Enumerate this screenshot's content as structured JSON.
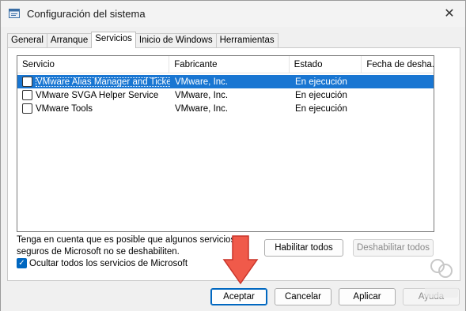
{
  "window": {
    "title": "Configuración del sistema",
    "close_icon": "close-icon",
    "app_icon": "system-config-icon"
  },
  "tabs": [
    {
      "label": "General"
    },
    {
      "label": "Arranque"
    },
    {
      "label": "Servicios",
      "active": true
    },
    {
      "label": "Inicio de Windows"
    },
    {
      "label": "Herramientas"
    }
  ],
  "services": {
    "columns": [
      "Servicio",
      "Fabricante",
      "Estado",
      "Fecha de desha..."
    ],
    "rows": [
      {
        "name": "VMware Alias Manager and Ticke...",
        "vendor": "VMware, Inc.",
        "status": "En ejecución",
        "date": "",
        "checked": false,
        "selected": true
      },
      {
        "name": "VMware SVGA Helper Service",
        "vendor": "VMware, Inc.",
        "status": "En ejecución",
        "date": "",
        "checked": false,
        "selected": false
      },
      {
        "name": "VMware Tools",
        "vendor": "VMware, Inc.",
        "status": "En ejecución",
        "date": "",
        "checked": false,
        "selected": false
      }
    ]
  },
  "notice": "Tenga en cuenta que es posible que algunos servicios seguros de Microsoft no se deshabiliten.",
  "buttons": {
    "enable_all": "Habilitar todos",
    "disable_all": "Deshabilitar todos",
    "ok": "Aceptar",
    "cancel": "Cancelar",
    "apply": "Aplicar",
    "help": "Ayuda"
  },
  "hide_ms": {
    "label": "Ocultar todos los servicios de Microsoft",
    "checked": true
  },
  "colors": {
    "selection": "#1976d2",
    "accent": "#0067c0",
    "arrow": "#f05a4a"
  }
}
